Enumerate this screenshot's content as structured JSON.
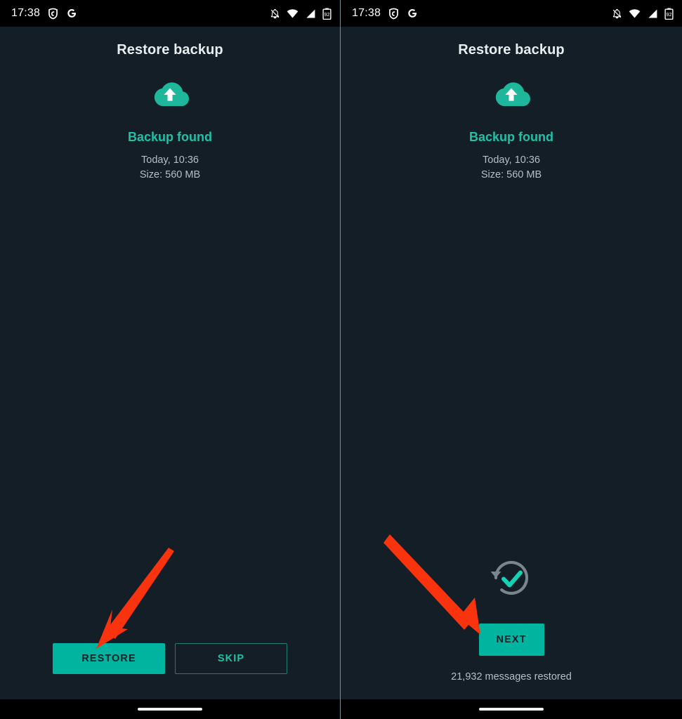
{
  "meta": {
    "accent_teal": "#00b4a0",
    "accent_teal_text": "#1fc2a7",
    "background": "#131e26",
    "arrow_color": "#f8330d"
  },
  "status_bar": {
    "clock": "17:38",
    "icons_left": [
      "adguard-icon",
      "google-icon"
    ],
    "icons_right": [
      "notifications-silenced-icon",
      "wifi-icon",
      "cellular-signal-icon",
      "battery-icon"
    ],
    "battery_level": "92"
  },
  "left_panel": {
    "title": "Restore backup",
    "cloud_icon": "cloud-upload-icon",
    "status_label": "Backup found",
    "backup_date": "Today, 10:36",
    "backup_size": "Size: 560 MB",
    "restore_button": "RESTORE",
    "skip_button": "SKIP",
    "annotation_arrow": "red-arrow-pointing-to-restore"
  },
  "right_panel": {
    "title": "Restore backup",
    "cloud_icon": "cloud-upload-icon",
    "status_label": "Backup found",
    "backup_date": "Today, 10:36",
    "backup_size": "Size: 560 MB",
    "restore_complete_icon": "restore-check-icon",
    "next_button": "NEXT",
    "restored_count": "21,932 messages restored",
    "annotation_arrow": "red-arrow-pointing-to-next"
  },
  "nav_bar": {
    "gesture_pill": "home-gesture-pill"
  }
}
